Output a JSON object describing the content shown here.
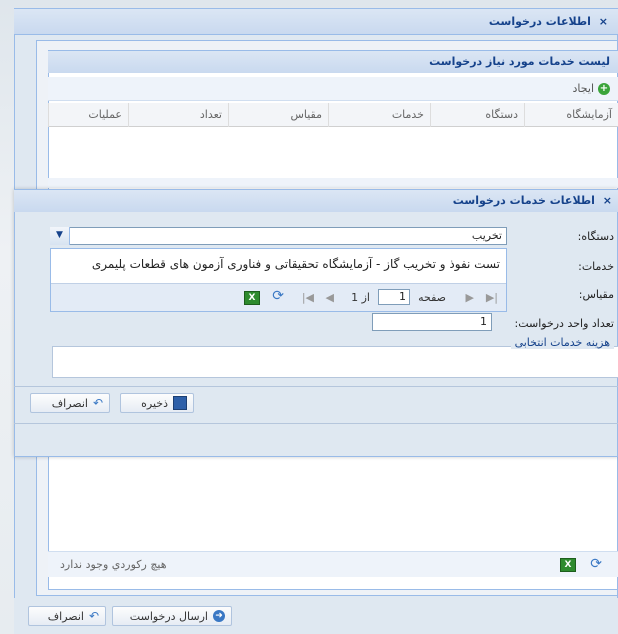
{
  "outer_window": {
    "title": "اطلاعات درخواست",
    "close_glyph": "×"
  },
  "grid": {
    "title": "لیست خدمات مورد نیاز درخواست",
    "create_label": "ایجاد",
    "columns": [
      "آزمایشگاه",
      "دستگاه",
      "خدمات",
      "مقیاس",
      "تعداد",
      "عملیات"
    ],
    "empty_text": "هیچ رکوردي وجود ندارد"
  },
  "bottom_buttons": {
    "send_label": "ارسال درخواست",
    "cancel_label": "انصراف"
  },
  "modal": {
    "title": "اطلاعات خدمات درخواست",
    "close_glyph": "×",
    "device_label": "دستگاه:",
    "device_value": "تخریب",
    "services_label": "خدمات:",
    "scale_label": "مقیاس:",
    "qty_label": "تعداد واحد درخواست:",
    "qty_value": "1",
    "fee_legend": "هزینه خدمات انتخابی",
    "save_label": "ذخیره",
    "cancel_label": "انصراف"
  },
  "dropdown": {
    "items": [
      "تست نفوذ و تخریب گاز - آزمایشگاه تحقیقاتی و فناوری آزمون های قطعات پلیمری"
    ],
    "paging": {
      "page_word": "صفحه",
      "page_value": "1",
      "of_text": "از 1"
    }
  },
  "colors": {
    "accent": "#15428b",
    "border": "#99bbe8",
    "panel": "#dfe8f1"
  }
}
